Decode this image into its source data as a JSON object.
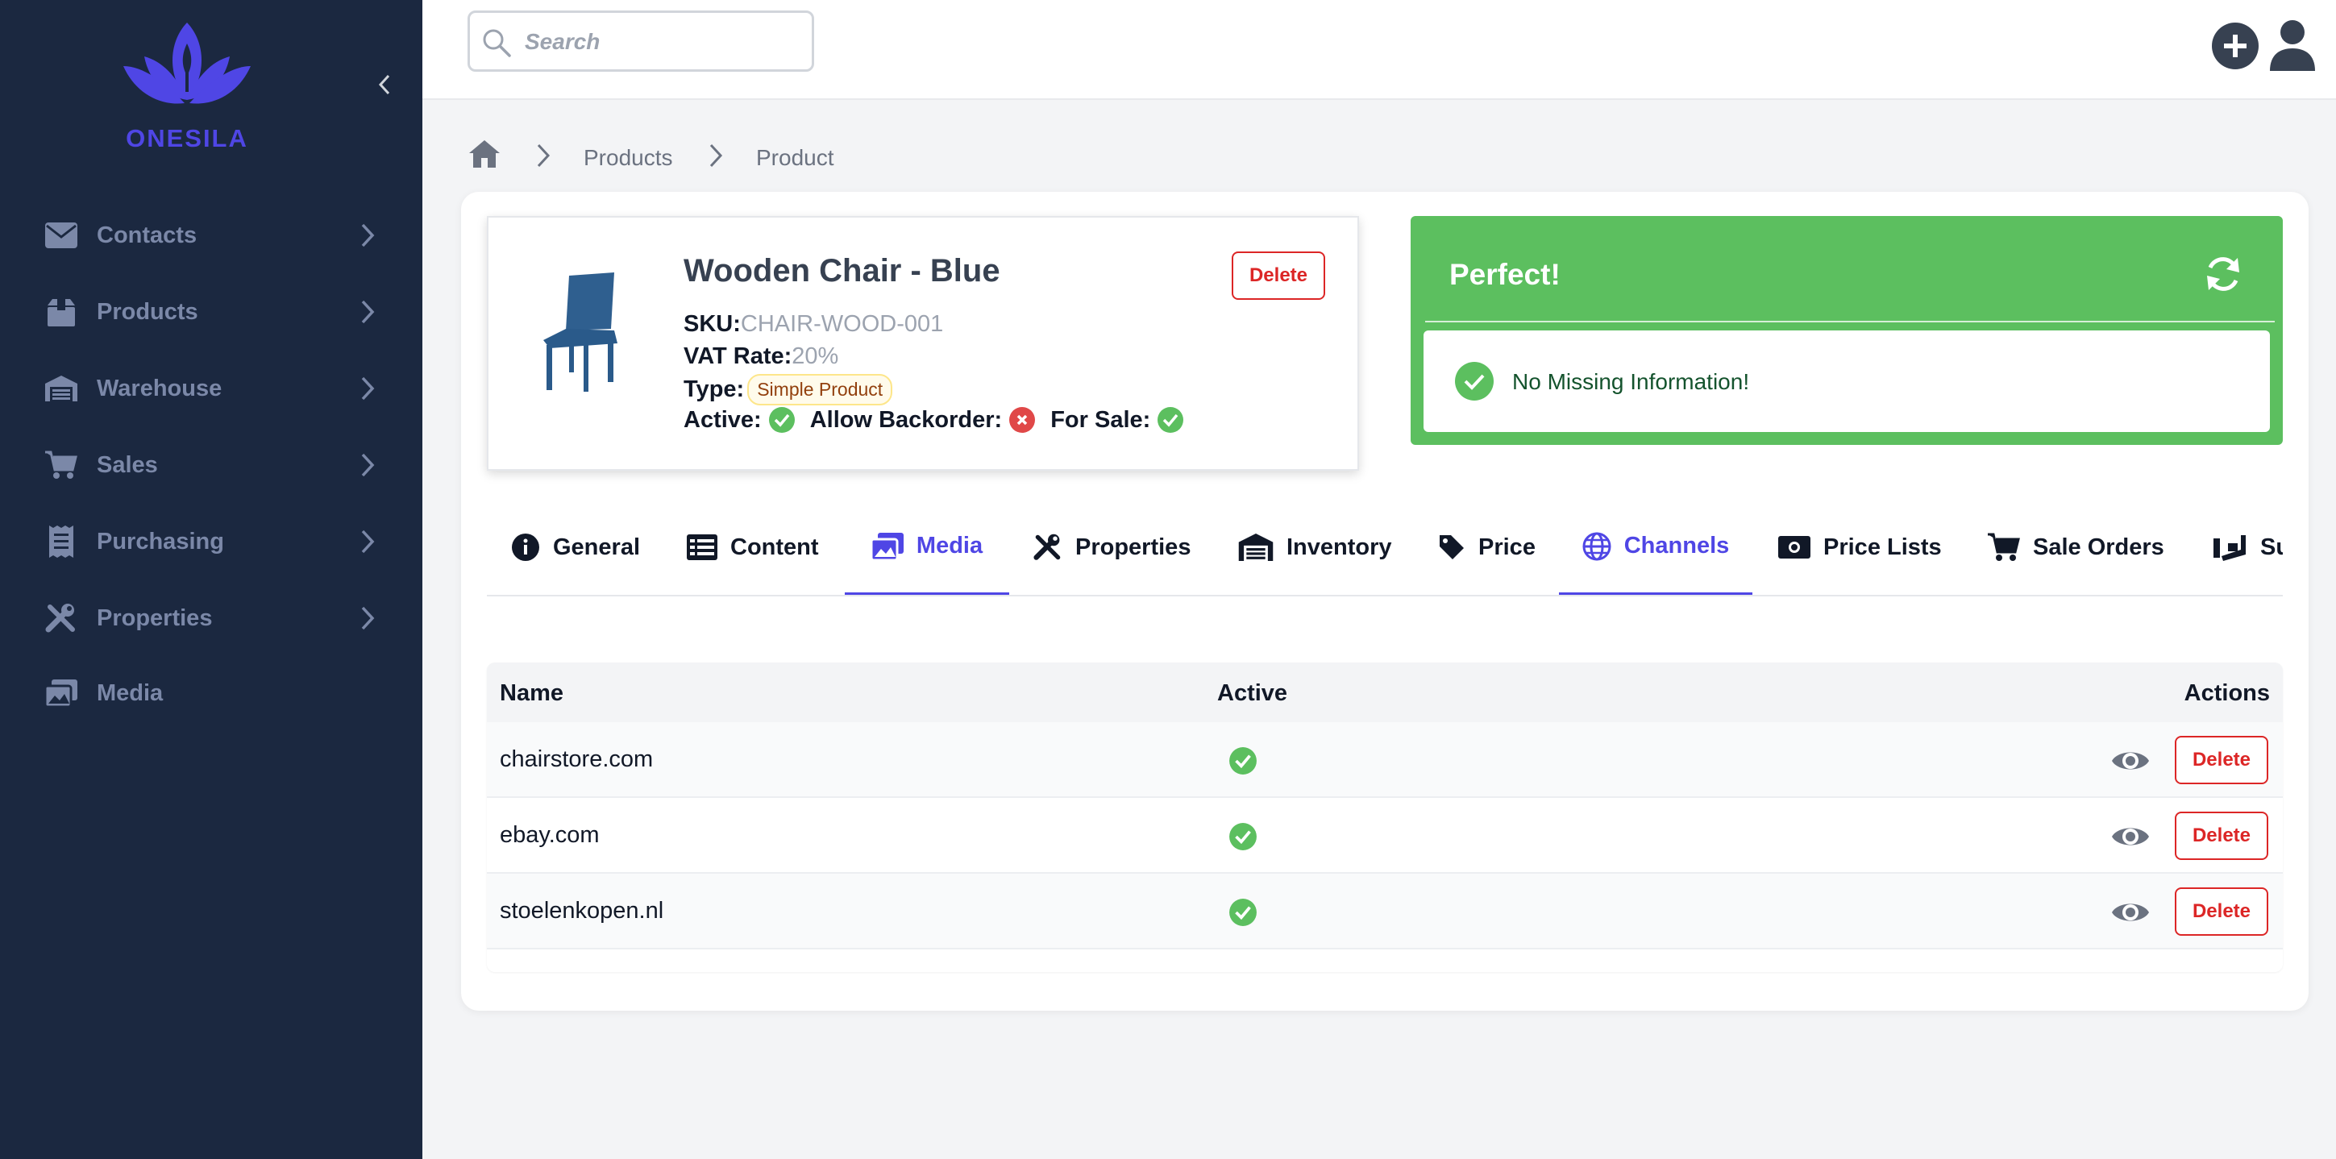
{
  "app": {
    "name": "ONESILA"
  },
  "colors": {
    "sidebar": "#1b2840",
    "brand": "#4f46e5",
    "success": "#5cbf5f",
    "danger": "#dc2626"
  },
  "search": {
    "placeholder": "Search"
  },
  "sidebar": {
    "items": [
      {
        "label": "Contacts",
        "icon": "envelope-icon",
        "has_children": true
      },
      {
        "label": "Products",
        "icon": "box-icon",
        "has_children": true
      },
      {
        "label": "Warehouse",
        "icon": "warehouse-icon",
        "has_children": true
      },
      {
        "label": "Sales",
        "icon": "cart-icon",
        "has_children": true
      },
      {
        "label": "Purchasing",
        "icon": "receipt-icon",
        "has_children": true
      },
      {
        "label": "Properties",
        "icon": "tools-icon",
        "has_children": true
      },
      {
        "label": "Media",
        "icon": "images-icon",
        "has_children": false
      }
    ]
  },
  "breadcrumb": {
    "items": [
      "Products",
      "Product"
    ]
  },
  "product": {
    "title": "Wooden Chair - Blue",
    "delete_label": "Delete",
    "sku_label": "SKU:",
    "sku": "CHAIR-WOOD-001",
    "vat_label": "VAT Rate:",
    "vat": "20%",
    "type_label": "Type:",
    "type": "Simple Product",
    "active_label": "Active:",
    "active": true,
    "backorder_label": "Allow Backorder:",
    "backorder": false,
    "for_sale_label": "For Sale:",
    "for_sale": true
  },
  "status": {
    "title": "Perfect!",
    "message": "No Missing Information!"
  },
  "tabs": [
    {
      "label": "General",
      "icon": "info-icon",
      "active": false
    },
    {
      "label": "Content",
      "icon": "list-icon",
      "active": false
    },
    {
      "label": "Media",
      "icon": "images-icon",
      "active": true
    },
    {
      "label": "Properties",
      "icon": "tools-icon",
      "active": false
    },
    {
      "label": "Inventory",
      "icon": "warehouse-icon",
      "active": false
    },
    {
      "label": "Price",
      "icon": "tag-icon",
      "active": false
    },
    {
      "label": "Channels",
      "icon": "globe-icon",
      "active": true
    },
    {
      "label": "Price Lists",
      "icon": "money-icon",
      "active": false
    },
    {
      "label": "Sale Orders",
      "icon": "cart-icon",
      "active": false
    },
    {
      "label": "Su",
      "icon": "truck-icon",
      "active": false
    }
  ],
  "table": {
    "headers": {
      "name": "Name",
      "active": "Active",
      "actions": "Actions"
    },
    "rows": [
      {
        "name": "chairstore.com",
        "active": true,
        "delete_label": "Delete"
      },
      {
        "name": "ebay.com",
        "active": true,
        "delete_label": "Delete"
      },
      {
        "name": "stoelenkopen.nl",
        "active": true,
        "delete_label": "Delete"
      }
    ]
  }
}
